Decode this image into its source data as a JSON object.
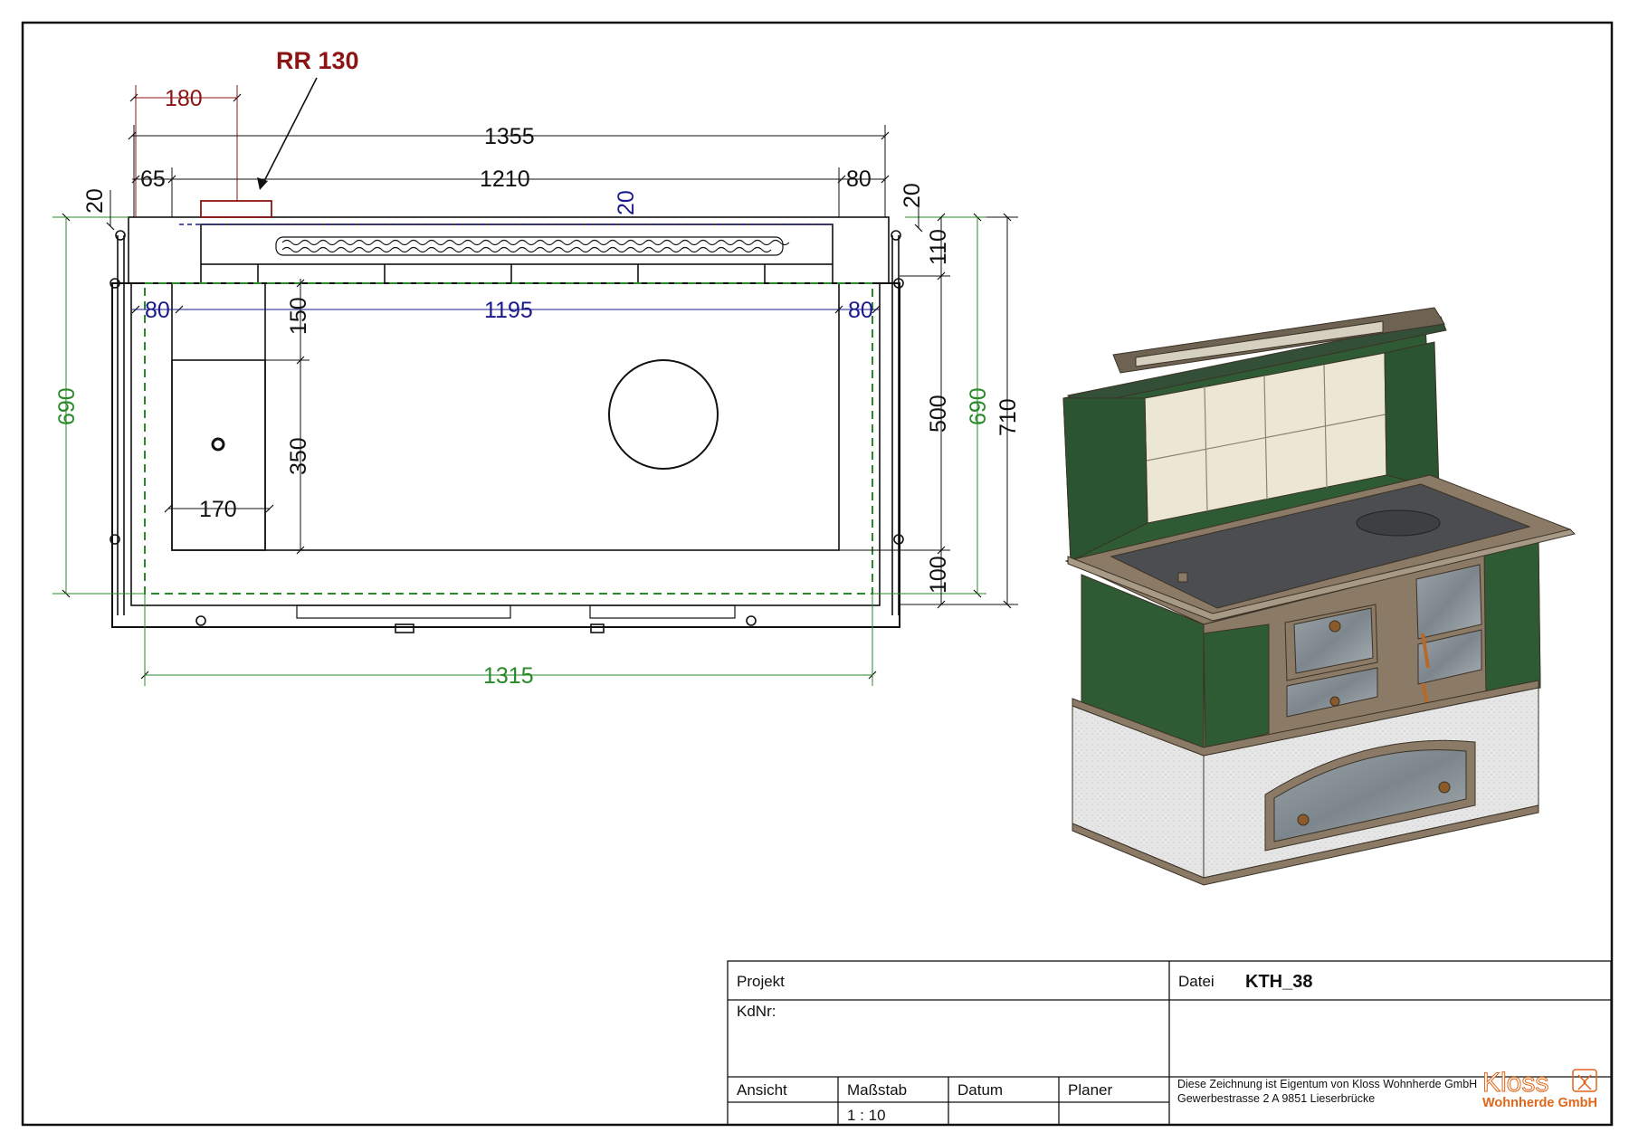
{
  "colors": {
    "black": "#111111",
    "dim_green": "#2a8a2a",
    "dim_blue": "#1a1a8c",
    "dim_red": "#8b1414",
    "tile_green": "#2e5a34",
    "tile_cream": "#ece7d2",
    "frame_brown": "#8a7a66",
    "plaster": "#e8e8e8",
    "brand_orange": "#e0661a"
  },
  "drawing": {
    "flue_label": "RR 130",
    "dims": {
      "flue_offset": "180",
      "overall_width": "1355",
      "left_edge": "65",
      "inner_width": "1210",
      "right_edge": "80",
      "left_top": "20",
      "right_top": "20",
      "backsplash_inset": "20",
      "backsplash_depth": "110",
      "left_margin": "80",
      "hob_width": "1195",
      "right_margin": "80",
      "oven_top": "150",
      "oven_height": "350",
      "oven_width": "170",
      "hob_depth": "500",
      "front_margin": "100",
      "depth_690_left": "690",
      "depth_690_right": "690",
      "total_depth": "710",
      "base_width": "1315"
    }
  },
  "title_block": {
    "project_label": "Projekt",
    "customer_label": "KdNr:",
    "file_label": "Datei",
    "file_value": "KTH_38",
    "view_label": "Ansicht",
    "scale_label": "Maßstab",
    "scale_value": "1 : 10",
    "date_label": "Datum",
    "planner_label": "Planer",
    "ownership_line1": "Diese Zeichnung ist Eigentum von Kloss Wohnherde GmbH",
    "ownership_line2": "Gewerbestrasse 2 A 9851 Lieserbrücke",
    "logo_word": "Kloss",
    "logo_company": "Wohnherde GmbH"
  }
}
